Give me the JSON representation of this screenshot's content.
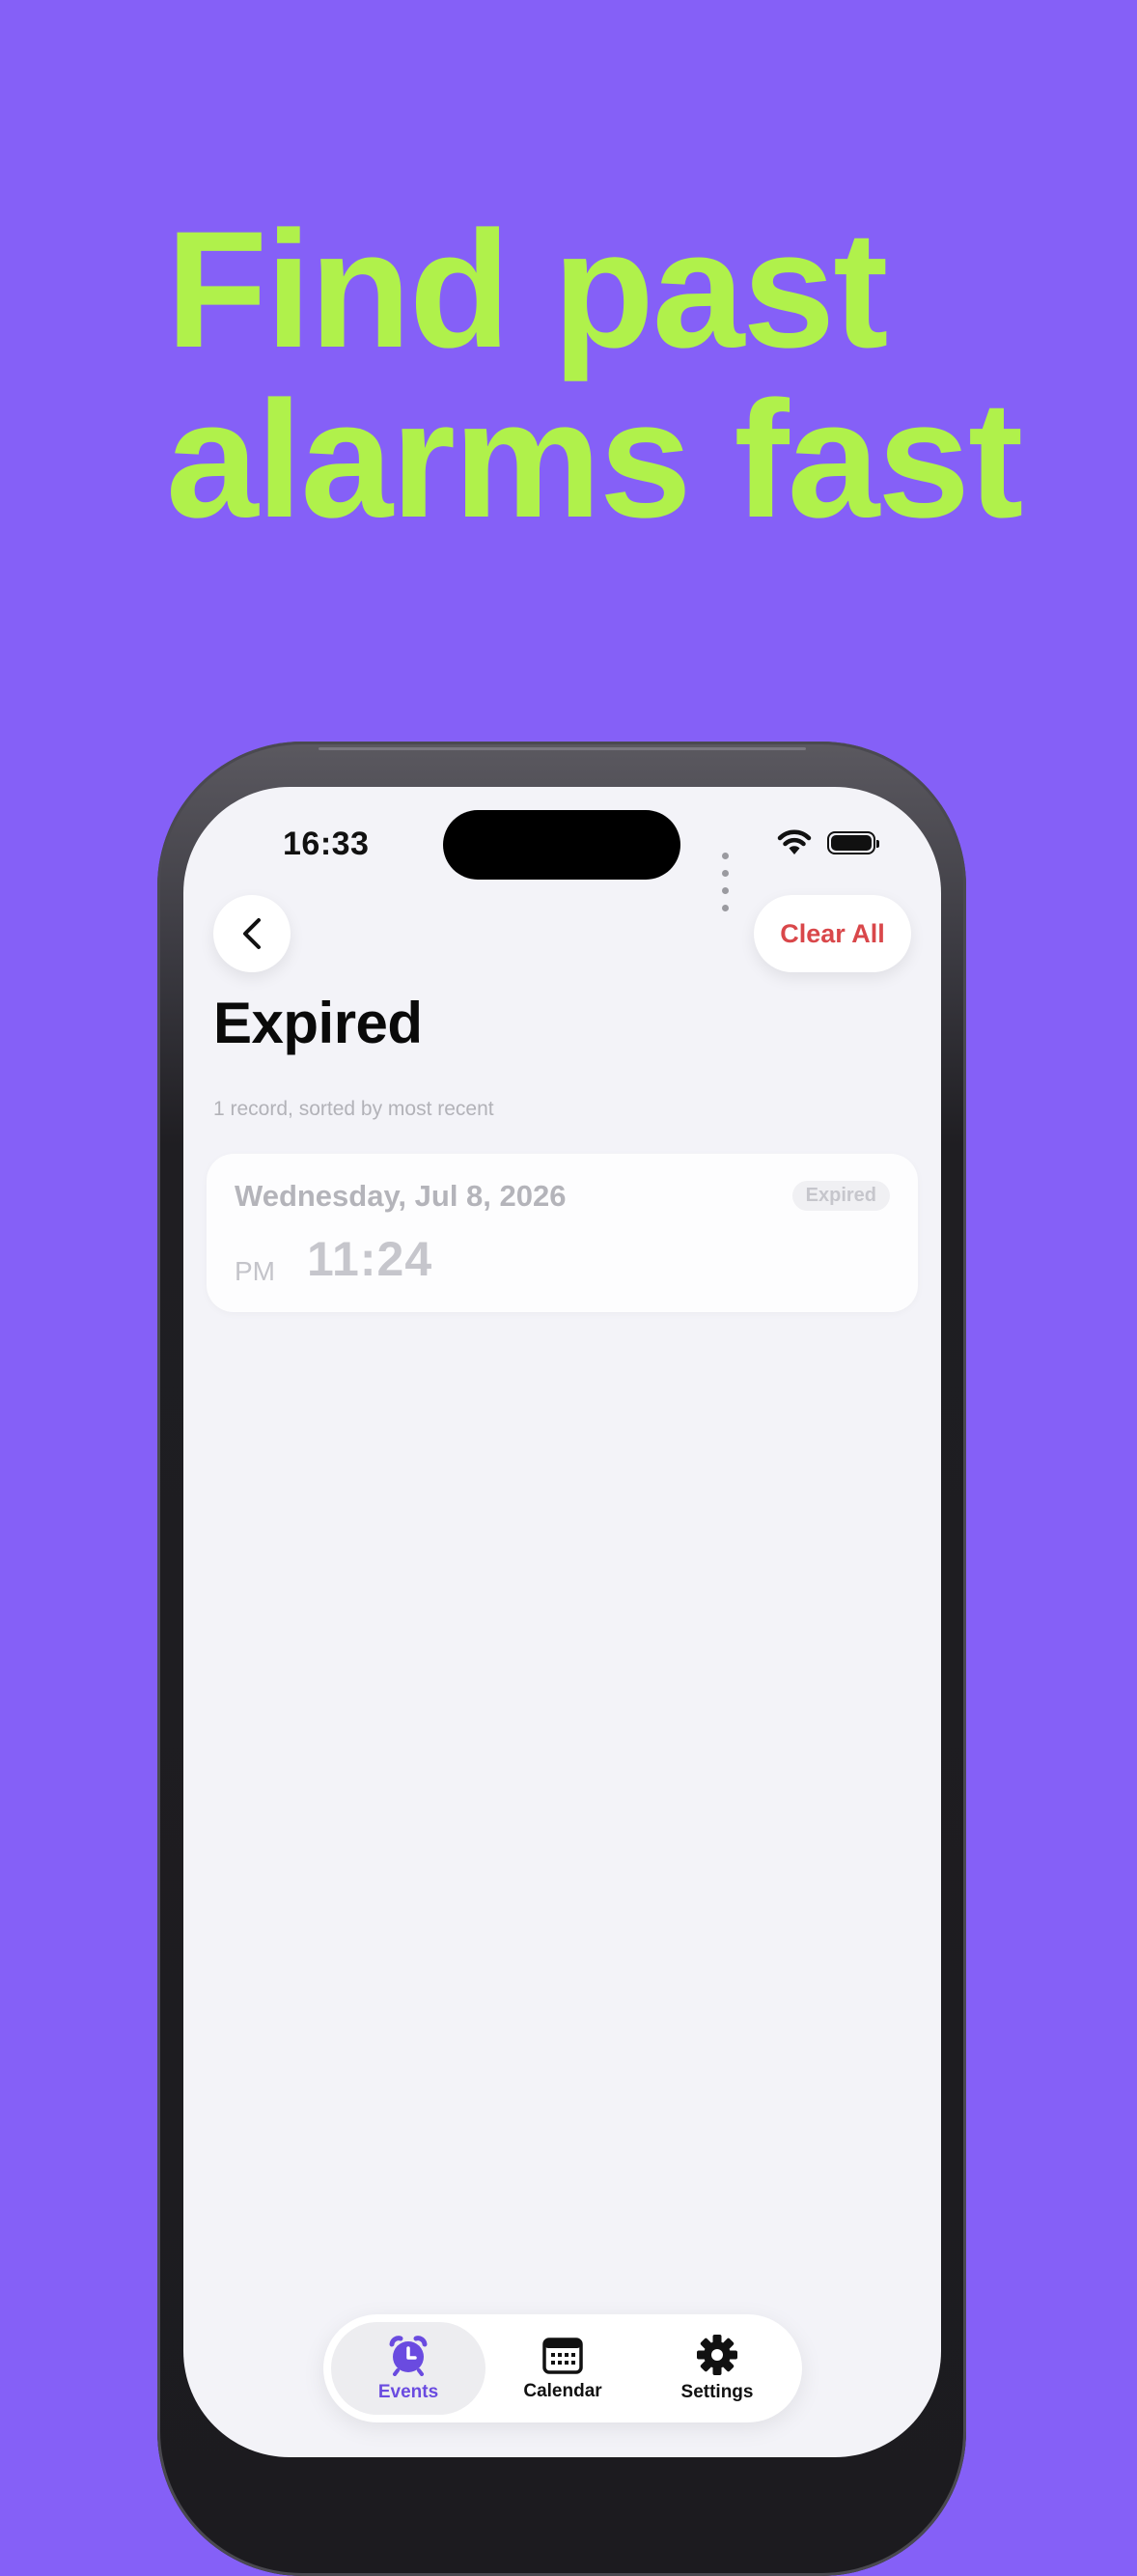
{
  "headline": {
    "line1": "Find past",
    "line2": "alarms fast"
  },
  "status_bar": {
    "time": "16:33"
  },
  "header": {
    "back_icon": "chevron-left-icon",
    "clear_all_label": "Clear All"
  },
  "page": {
    "title": "Expired",
    "subtitle": "1 record, sorted by most recent"
  },
  "records": [
    {
      "date": "Wednesday, Jul 8, 2026",
      "badge": "Expired",
      "ampm": "PM",
      "time": "11:24"
    }
  ],
  "tabs": [
    {
      "label": "Events",
      "icon": "alarm-clock-icon",
      "active": true
    },
    {
      "label": "Calendar",
      "icon": "calendar-icon",
      "active": false
    },
    {
      "label": "Settings",
      "icon": "gear-icon",
      "active": false
    }
  ],
  "colors": {
    "background": "#8560F7",
    "headline": "#B0F14B",
    "accent": "#6A4BE0",
    "danger": "#D9474A",
    "screen": "#F3F3F8"
  }
}
